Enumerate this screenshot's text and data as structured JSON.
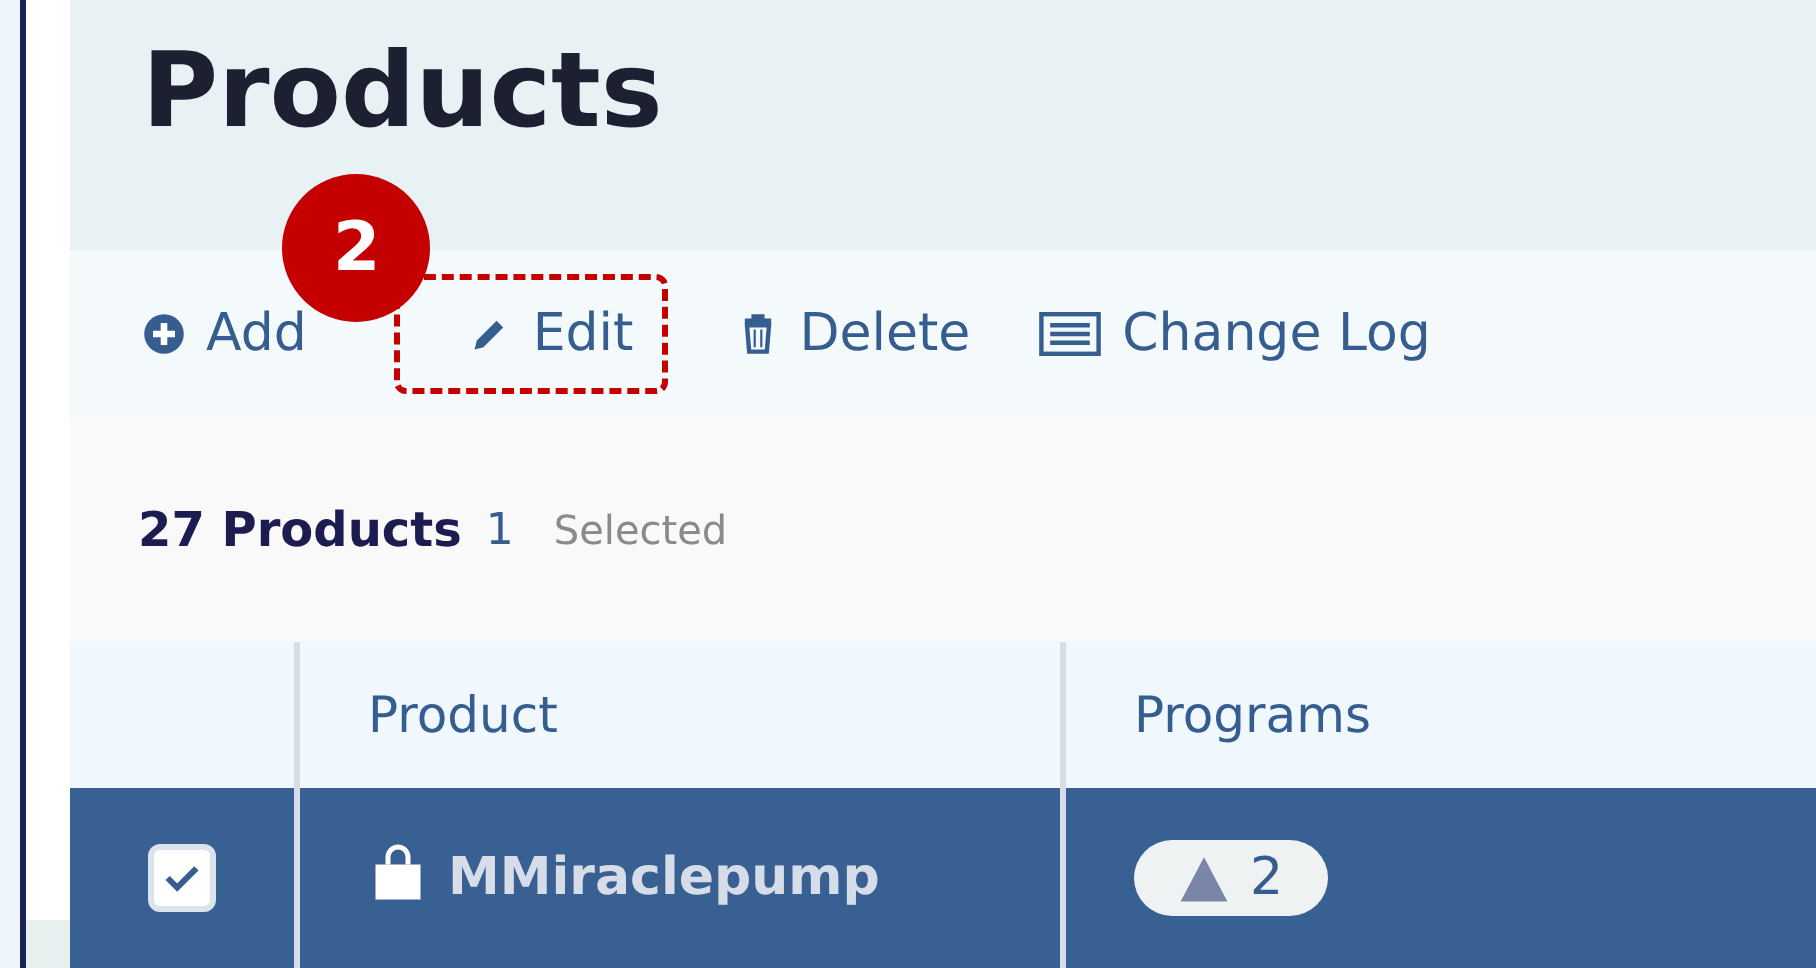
{
  "page": {
    "title": "Products"
  },
  "annotation": {
    "step": "2"
  },
  "toolbar": [
    {
      "kind": "add",
      "label": "Add",
      "highlighted": false
    },
    {
      "kind": "edit",
      "label": "Edit",
      "highlighted": true
    },
    {
      "kind": "delete",
      "label": "Delete",
      "highlighted": false
    },
    {
      "kind": "log",
      "label": "Change Log",
      "highlighted": false
    }
  ],
  "summary": {
    "count": "27 Products",
    "selected_count": "1",
    "selected_label": "Selected"
  },
  "table": {
    "columns": [
      "Product",
      "Programs"
    ],
    "rows": [
      {
        "selected": true,
        "product": "MMiraclepump",
        "programs": "2"
      }
    ]
  }
}
